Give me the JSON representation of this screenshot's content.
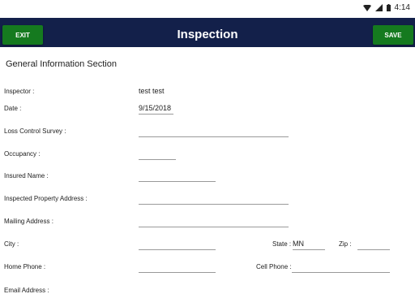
{
  "status_bar": {
    "time": "4:14"
  },
  "header": {
    "exit_label": "EXIT",
    "title": "Inspection",
    "save_label": "SAVE"
  },
  "section_title": "General Information Section",
  "fields": {
    "inspector": {
      "label": "Inspector :",
      "value": "test test"
    },
    "date": {
      "label": "Date :",
      "value": "9/15/2018"
    },
    "loss_control_survey": {
      "label": "Loss Control Survey :",
      "value": ""
    },
    "occupancy": {
      "label": "Occupancy :",
      "value": ""
    },
    "insured_name": {
      "label": "Insured Name :",
      "value": ""
    },
    "inspected_property_address": {
      "label": "Inspected Property Address :",
      "value": ""
    },
    "mailing_address": {
      "label": "Mailing Address :",
      "value": ""
    },
    "city": {
      "label": "City :",
      "value": ""
    },
    "state": {
      "label": "State :",
      "value": "MN"
    },
    "zip": {
      "label": "Zip :",
      "value": ""
    },
    "home_phone": {
      "label": "Home Phone :",
      "value": ""
    },
    "cell_phone": {
      "label": "Cell Phone :",
      "value": ""
    },
    "email": {
      "label": "Email Address :"
    }
  }
}
